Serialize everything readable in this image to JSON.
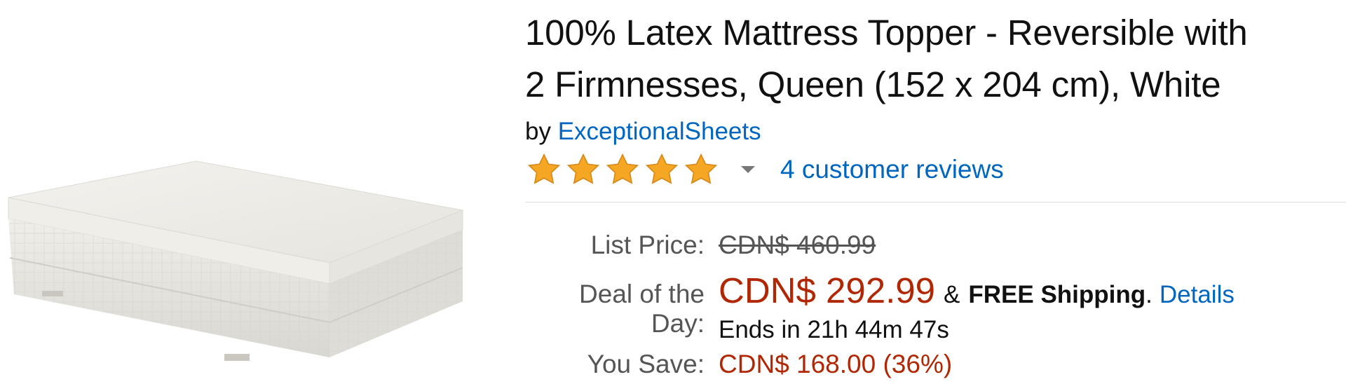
{
  "product": {
    "title_line1": "100% Latex Mattress Topper - Reversible with",
    "title_line2": "2 Firmnesses, Queen (152 x 204 cm), White",
    "by_prefix": "by",
    "brand": "ExceptionalSheets",
    "rating": {
      "stars": 5,
      "max": 5,
      "reviews_text": "4 customer reviews"
    }
  },
  "pricing": {
    "list_price_label": "List Price:",
    "list_price": "CDN$ 460.99",
    "deal_label": "Deal of the Day:",
    "deal_price": "CDN$ 292.99",
    "shipping_amp": "&",
    "shipping_text": "FREE Shipping",
    "shipping_period": ".",
    "details_link": "Details",
    "ends_text": "Ends in 21h 44m 47s",
    "you_save_label": "You Save:",
    "you_save": "CDN$ 168.00 (36%)"
  },
  "colors": {
    "link": "#0066c0",
    "price": "#b12704",
    "star": "#f5a623"
  },
  "icons": {
    "star": "star-icon",
    "caret": "chevron-down-icon"
  }
}
